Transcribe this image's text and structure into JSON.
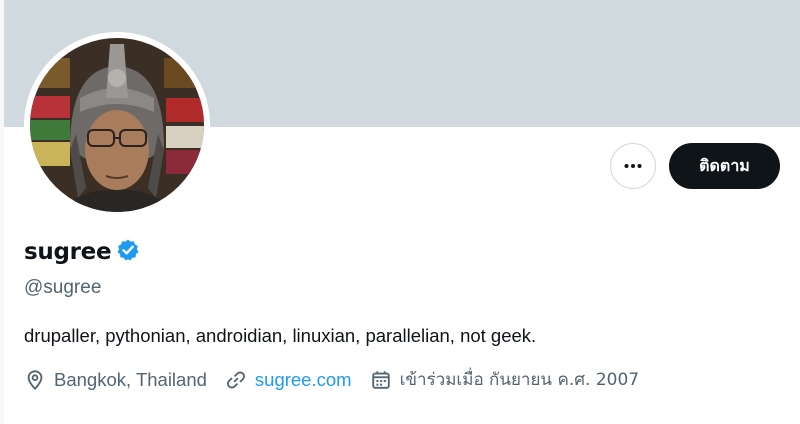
{
  "profile": {
    "display_name": "sugree",
    "handle": "@sugree",
    "bio": "drupaller, pythonian, androidian, linuxian, parallelian, not geek.",
    "location": "Bangkok, Thailand",
    "website": "sugree.com",
    "joined": "เข้าร่วมเมื่อ กันยายน ค.ศ. 2007",
    "verified": true
  },
  "actions": {
    "follow_label": "ติดตาม"
  },
  "icons": {
    "more": "more-horizontal-icon",
    "verified": "verified-badge-icon",
    "location": "location-pin-icon",
    "link": "link-icon",
    "calendar": "calendar-icon"
  },
  "colors": {
    "banner": "#cfd9de",
    "accent": "#1d9bf0",
    "primary_text": "#0f1419",
    "secondary_text": "#536471",
    "follow_button_bg": "#0f1419"
  }
}
